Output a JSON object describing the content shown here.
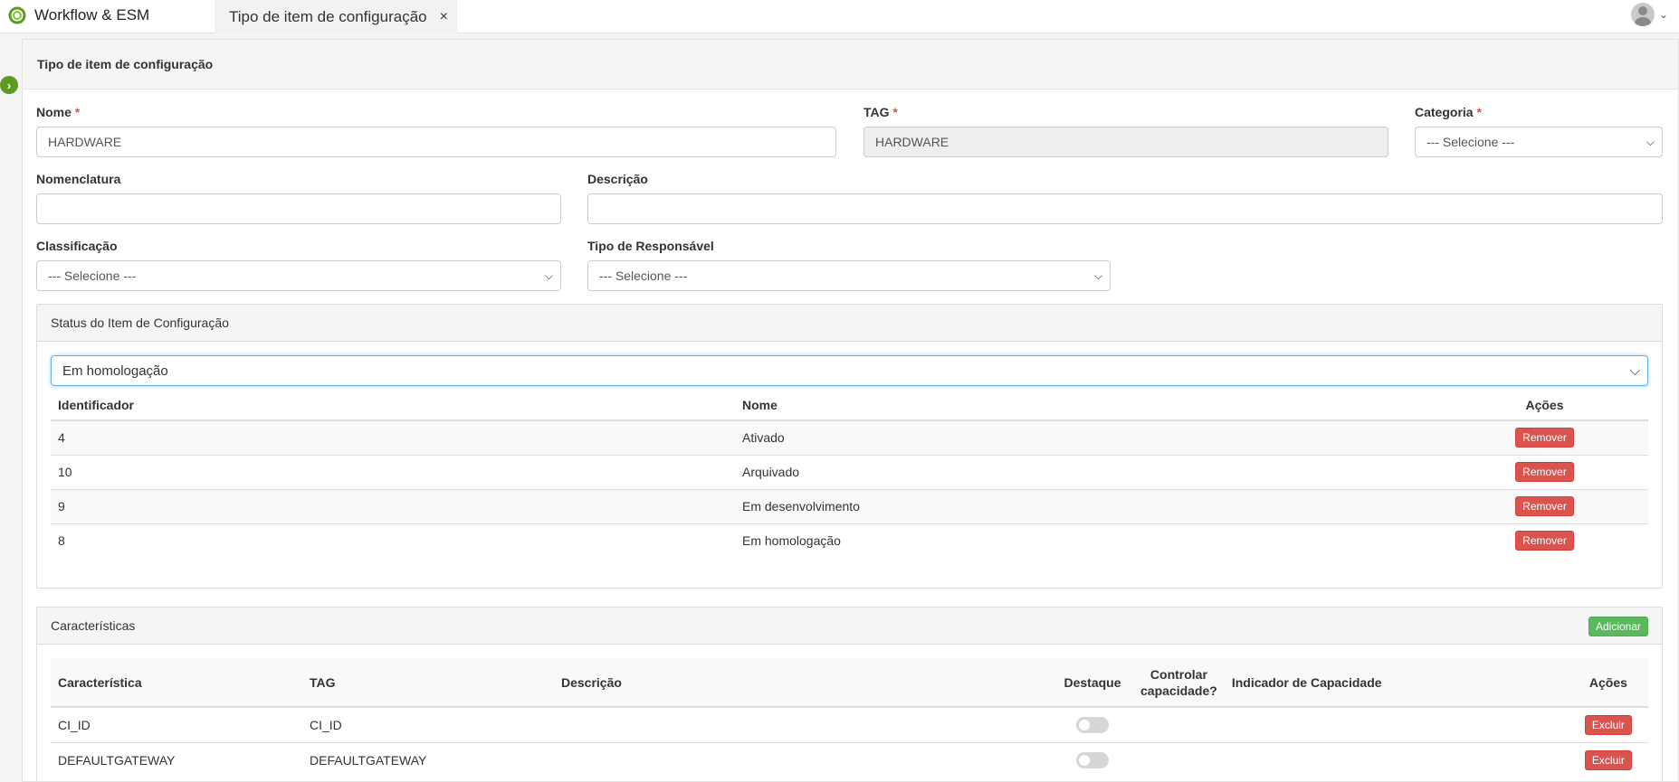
{
  "app": {
    "name": "Workflow & ESM"
  },
  "tab": {
    "label": "Tipo de item de configuração",
    "close": "×"
  },
  "panel": {
    "title": "Tipo de item de configuração"
  },
  "form": {
    "nome": {
      "label": "Nome",
      "value": "HARDWARE"
    },
    "tag": {
      "label": "TAG",
      "value": "HARDWARE"
    },
    "categoria": {
      "label": "Categoria",
      "selected": "--- Selecione ---"
    },
    "nomenclatura": {
      "label": "Nomenclatura",
      "value": ""
    },
    "descricao": {
      "label": "Descrição",
      "value": ""
    },
    "classificacao": {
      "label": "Classificação",
      "selected": "--- Selecione ---"
    },
    "tipo_responsavel": {
      "label": "Tipo de Responsável",
      "selected": "--- Selecione ---"
    },
    "required_mark": "*"
  },
  "status_panel": {
    "title": "Status do Item de Configuração",
    "selected": "Em homologação",
    "columns": {
      "id": "Identificador",
      "nome": "Nome",
      "acoes": "Ações"
    },
    "rows": [
      {
        "id": "4",
        "nome": "Ativado",
        "action": "Remover"
      },
      {
        "id": "10",
        "nome": "Arquivado",
        "action": "Remover"
      },
      {
        "id": "9",
        "nome": "Em desenvolvimento",
        "action": "Remover"
      },
      {
        "id": "8",
        "nome": "Em homologação",
        "action": "Remover"
      }
    ]
  },
  "caracteristicas": {
    "title": "Características",
    "add_label": "Adicionar",
    "columns": {
      "caracteristica": "Característica",
      "tag": "TAG",
      "descricao": "Descrição",
      "destaque": "Destaque",
      "controlar_1": "Controlar",
      "controlar_2": "capacidade?",
      "indicador": "Indicador de Capacidade",
      "acoes": "Ações"
    },
    "rows": [
      {
        "caracteristica": "CI_ID",
        "tag": "CI_ID",
        "descricao": "",
        "destaque": false,
        "action": "Excluir"
      },
      {
        "caracteristica": "DEFAULTGATEWAY",
        "tag": "DEFAULTGATEWAY",
        "descricao": "",
        "destaque": false,
        "action": "Excluir"
      }
    ]
  },
  "colors": {
    "brand_green": "#5d9a1f",
    "danger": "#d9534f",
    "success": "#5cb85c",
    "focus": "#66afe9"
  },
  "icons": {
    "logo": "workflow-logo-icon",
    "avatar": "user-avatar-icon",
    "sidebar": "chevron-right-icon"
  }
}
